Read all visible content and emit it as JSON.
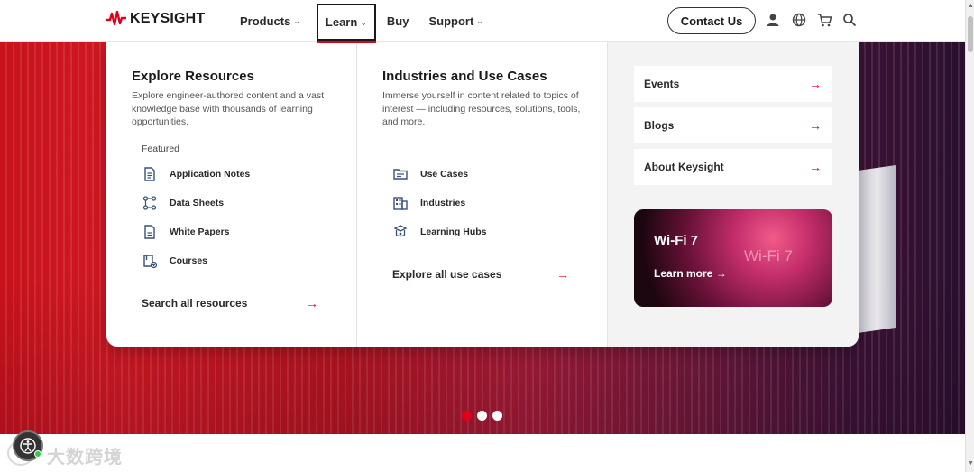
{
  "header": {
    "logo_text": "KEYSIGHT",
    "nav": [
      {
        "label": "Products"
      },
      {
        "label": "Learn"
      },
      {
        "label": "Buy"
      },
      {
        "label": "Support"
      }
    ],
    "contact_label": "Contact Us",
    "icons": [
      "user-icon",
      "globe-icon",
      "cart-icon",
      "search-icon"
    ],
    "accent_color": "#e0001b"
  },
  "mega_menu": {
    "explore": {
      "title": "Explore Resources",
      "description": "Explore engineer-authored content and a vast knowledge base with thousands of learning opportunities.",
      "featured_label": "Featured",
      "items": [
        {
          "label": "Application Notes",
          "icon": "document-icon"
        },
        {
          "label": "Data Sheets",
          "icon": "nodes-icon"
        },
        {
          "label": "White Papers",
          "icon": "page-icon"
        },
        {
          "label": "Courses",
          "icon": "course-icon"
        }
      ],
      "link": "Search all resources"
    },
    "industries": {
      "title": "Industries and Use Cases",
      "description": "Immerse yourself in content related to topics of interest — including resources, solutions, tools, and more.",
      "items": [
        {
          "label": "Use Cases",
          "icon": "folder-icon"
        },
        {
          "label": "Industries",
          "icon": "building-icon"
        },
        {
          "label": "Learning Hubs",
          "icon": "hub-icon"
        }
      ],
      "link": "Explore all use cases"
    },
    "side": {
      "cards": [
        {
          "label": "Events"
        },
        {
          "label": "Blogs"
        },
        {
          "label": "About Keysight"
        }
      ],
      "promo": {
        "title": "Wi-Fi 7",
        "watermark": "Wi-Fi 7",
        "link": "Learn more"
      }
    }
  },
  "carousel": {
    "slide_count": 3,
    "active_index": 0
  },
  "watermark": {
    "text": "大数跨境"
  }
}
